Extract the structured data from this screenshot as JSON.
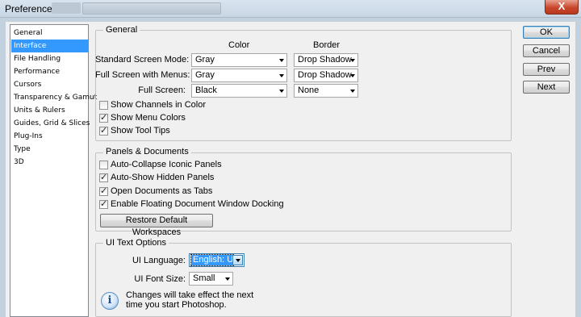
{
  "window": {
    "title": "Preferences",
    "close_glyph": "X"
  },
  "sidebar": {
    "items": [
      {
        "label": "General"
      },
      {
        "label": "Interface",
        "selected": true
      },
      {
        "label": "File Handling"
      },
      {
        "label": "Performance"
      },
      {
        "label": "Cursors"
      },
      {
        "label": "Transparency & Gamut"
      },
      {
        "label": "Units & Rulers"
      },
      {
        "label": "Guides, Grid & Slices"
      },
      {
        "label": "Plug-Ins"
      },
      {
        "label": "Type"
      },
      {
        "label": "3D"
      }
    ]
  },
  "general": {
    "title": "General",
    "col_color": "Color",
    "col_border": "Border",
    "rows": [
      {
        "label": "Standard Screen Mode:",
        "color": "Gray",
        "border": "Drop Shadow"
      },
      {
        "label": "Full Screen with Menus:",
        "color": "Gray",
        "border": "Drop Shadow"
      },
      {
        "label": "Full Screen:",
        "color": "Black",
        "border": "None"
      }
    ],
    "checks": [
      {
        "label": "Show Channels in Color",
        "checked": false
      },
      {
        "label": "Show Menu Colors",
        "checked": true
      },
      {
        "label": "Show Tool Tips",
        "checked": true
      }
    ]
  },
  "panels": {
    "title": "Panels & Documents",
    "checks": [
      {
        "label": "Auto-Collapse Iconic Panels",
        "checked": false
      },
      {
        "label": "Auto-Show Hidden Panels",
        "checked": true
      },
      {
        "label": "Open Documents as Tabs",
        "checked": true
      },
      {
        "label": "Enable Floating Document Window Docking",
        "checked": true
      }
    ],
    "restore_label": "Restore Default Workspaces"
  },
  "ui_text": {
    "title": "UI Text Options",
    "language_label": "UI Language:",
    "language_value": "English: UK",
    "font_size_label": "UI Font Size:",
    "font_size_value": "Small",
    "note_line1": "Changes will take effect the next",
    "note_line2": "time you start Photoshop.",
    "info_glyph": "i"
  },
  "buttons": {
    "ok": "OK",
    "cancel": "Cancel",
    "prev": "Prev",
    "next": "Next"
  },
  "check_glyph": "✓"
}
